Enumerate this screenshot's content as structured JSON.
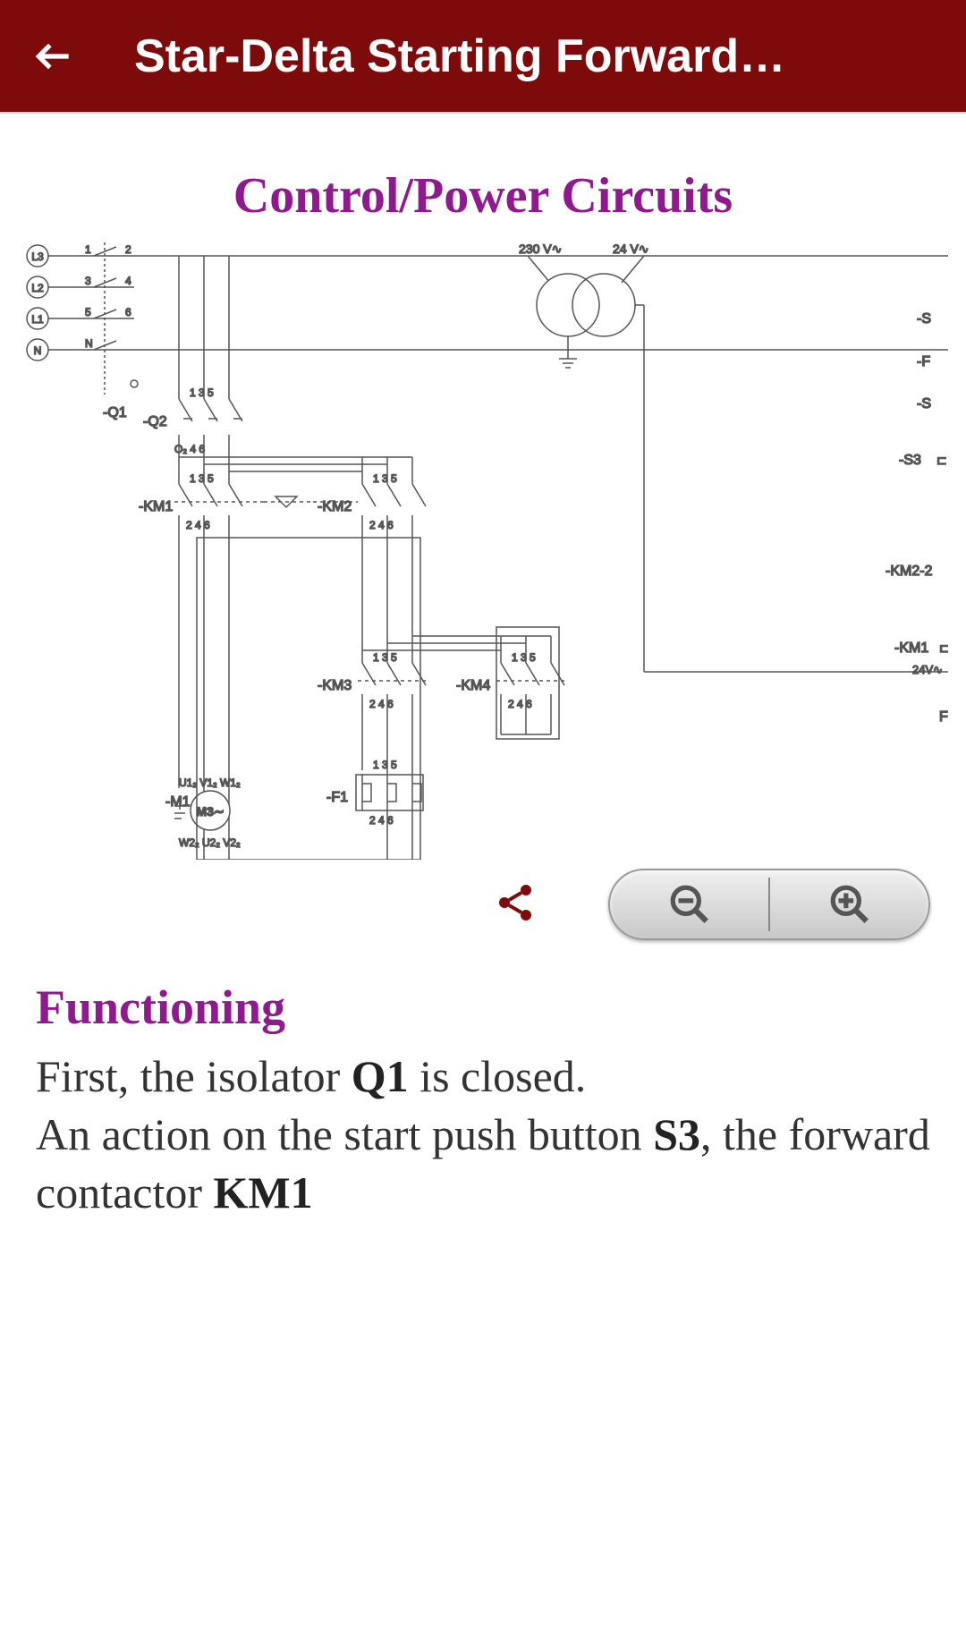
{
  "header": {
    "title": "Star-Delta Starting Forward…"
  },
  "section_title": "Control/Power Circuits",
  "diagram": {
    "supply_terminals": [
      "L3",
      "L2",
      "L1",
      "N"
    ],
    "switch_numbers_top": [
      "1",
      "2",
      "3",
      "4",
      "5",
      "6",
      "N"
    ],
    "voltages": {
      "primary": "230 V∿",
      "secondary": "24 V∿"
    },
    "devices": {
      "Q1": "-Q1",
      "Q2": "-Q2",
      "KM1": "-KM1",
      "KM2": "-KM2",
      "KM3": "-KM3",
      "KM4": "-KM4",
      "F1": "-F1",
      "M1": "-M1",
      "motor_label": "M3∼",
      "motor_terms_top": "U1₂ V1₂ W1₂",
      "motor_terms_bot": "W2₂ U2₂ V2₂"
    },
    "right_labels": [
      "-S",
      "-F",
      "-S",
      "-S3",
      "-KM2-2",
      "-KM1",
      "24V∿",
      "F"
    ],
    "contact_numbers": {
      "top": "1  3  5",
      "bot": "2  4  6"
    },
    "q2_bot": "O₂  4   6"
  },
  "functioning": {
    "heading": "Functioning",
    "text_parts": {
      "p1a": "First, the isolator ",
      "p1b": "Q1",
      "p1c": " is closed.",
      "p2a": "An action on the start push button ",
      "p2b": "S3",
      "p2c": ", the forward contactor ",
      "p2d": "KM1"
    }
  }
}
